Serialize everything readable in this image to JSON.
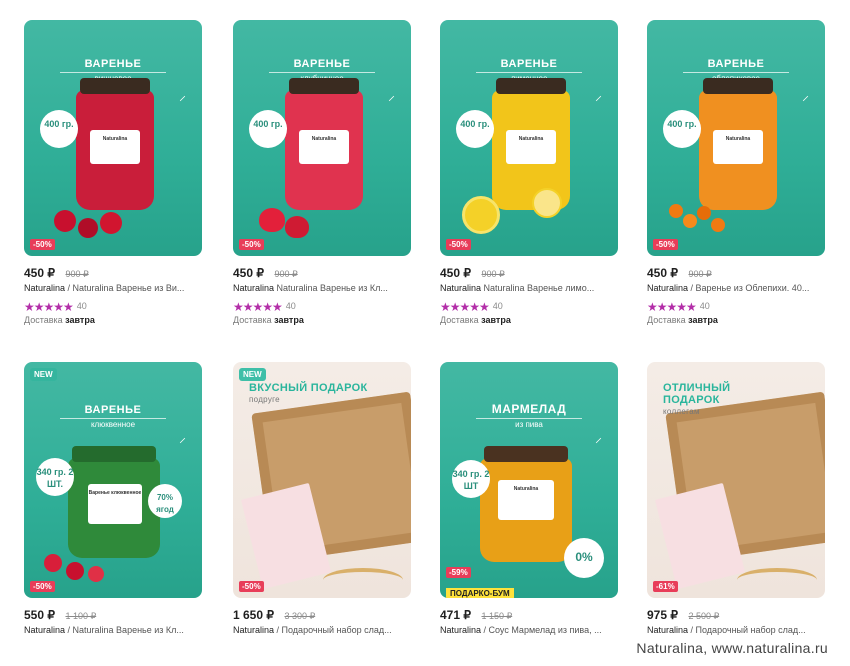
{
  "products": [
    {
      "title": "ВАРЕНЬЕ",
      "subtitle": "вишневое",
      "weight": "400 гр.",
      "discount": "-50%",
      "price": "450 ₽",
      "old_price": "900 ₽",
      "name_brand": "Naturalina",
      "name_rest": " / Naturalina Варенье из Ви...",
      "stars": "★★★★★",
      "rating_count": "40",
      "delivery_prefix": "Доставка ",
      "delivery_day": "завтра",
      "jar_color": "#c91e3a",
      "fruit_color": "#c8102e",
      "label_text": "Naturalina"
    },
    {
      "title": "ВАРЕНЬЕ",
      "subtitle": "клубничное",
      "weight": "400 гр.",
      "discount": "-50%",
      "price": "450 ₽",
      "old_price": "900 ₽",
      "name_brand": "Naturalina",
      "name_rest": " Naturalina Варенье из Кл...",
      "stars": "★★★★★",
      "rating_count": "40",
      "delivery_prefix": "Доставка ",
      "delivery_day": "завтра",
      "jar_color": "#e0334f",
      "fruit_color": "#e3203a",
      "label_text": "Naturalina"
    },
    {
      "title": "ВАРЕНЬЕ",
      "subtitle": "лимонное",
      "weight": "400 гр.",
      "discount": "-50%",
      "price": "450 ₽",
      "old_price": "900 ₽",
      "name_brand": "Naturalina",
      "name_rest": " Naturalina Варенье лимо...",
      "stars": "★★★★★",
      "rating_count": "40",
      "delivery_prefix": "Доставка ",
      "delivery_day": "завтра",
      "jar_color": "#f2c51a",
      "fruit_color": "#f4d128",
      "label_text": "Naturalina"
    },
    {
      "title": "ВАРЕНЬЕ",
      "subtitle": "облепиховое",
      "weight": "400 гр.",
      "discount": "-50%",
      "price": "450 ₽",
      "old_price": "900 ₽",
      "name_brand": "Naturalina",
      "name_rest": " / Варенье из Облепихи. 40...",
      "stars": "★★★★★",
      "rating_count": "40",
      "delivery_prefix": "Доставка ",
      "delivery_day": "завтра",
      "jar_color": "#f09020",
      "fruit_color": "#f07a12",
      "label_text": "Naturalina"
    },
    {
      "new_tag": "NEW",
      "title": "ВАРЕНЬЕ",
      "subtitle": "клюквенное",
      "weight": "340 гр. 2 ШТ.",
      "discount": "-50%",
      "price": "550 ₽",
      "old_price": "1 100 ₽",
      "name_brand": "Naturalina",
      "name_rest": " / Naturalina Варенье из Кл...",
      "jar_color": "#2f8a3a",
      "fruit_color": "#d81e3a",
      "label_text": "Варенье клюквенное",
      "badge": "70% ягод"
    },
    {
      "new_tag": "NEW",
      "gift_title": "ВКУСНЫЙ ПОДАРОК",
      "gift_sub": "подруге",
      "discount": "-50%",
      "price": "1 650 ₽",
      "old_price": "3 300 ₽",
      "name_brand": "Naturalina",
      "name_rest": " / Подарочный набор слад..."
    },
    {
      "title": "МАРМЕЛАД",
      "subtitle": "из пива",
      "weight": "340 гр. 2 ШТ",
      "discount": "-59%",
      "promo": "ПОДАРКО-БУМ",
      "price": "471 ₽",
      "old_price": "1 150 ₽",
      "name_brand": "Naturalina",
      "name_rest": " / Соус Мармелад из пива, ...",
      "jar_color": "#e8a017",
      "fruit_color": "#f4d128",
      "label_text": "Naturalina",
      "badge": "0%"
    },
    {
      "gift_title": "ОТЛИЧНЫЙ ПОДАРОК",
      "gift_sub": "коллегам",
      "discount": "-61%",
      "price": "975 ₽",
      "old_price": "2 500 ₽",
      "name_brand": "Naturalina",
      "name_rest": " / Подарочный набор слад..."
    }
  ],
  "watermark": "Naturalina, www.naturalina.ru"
}
